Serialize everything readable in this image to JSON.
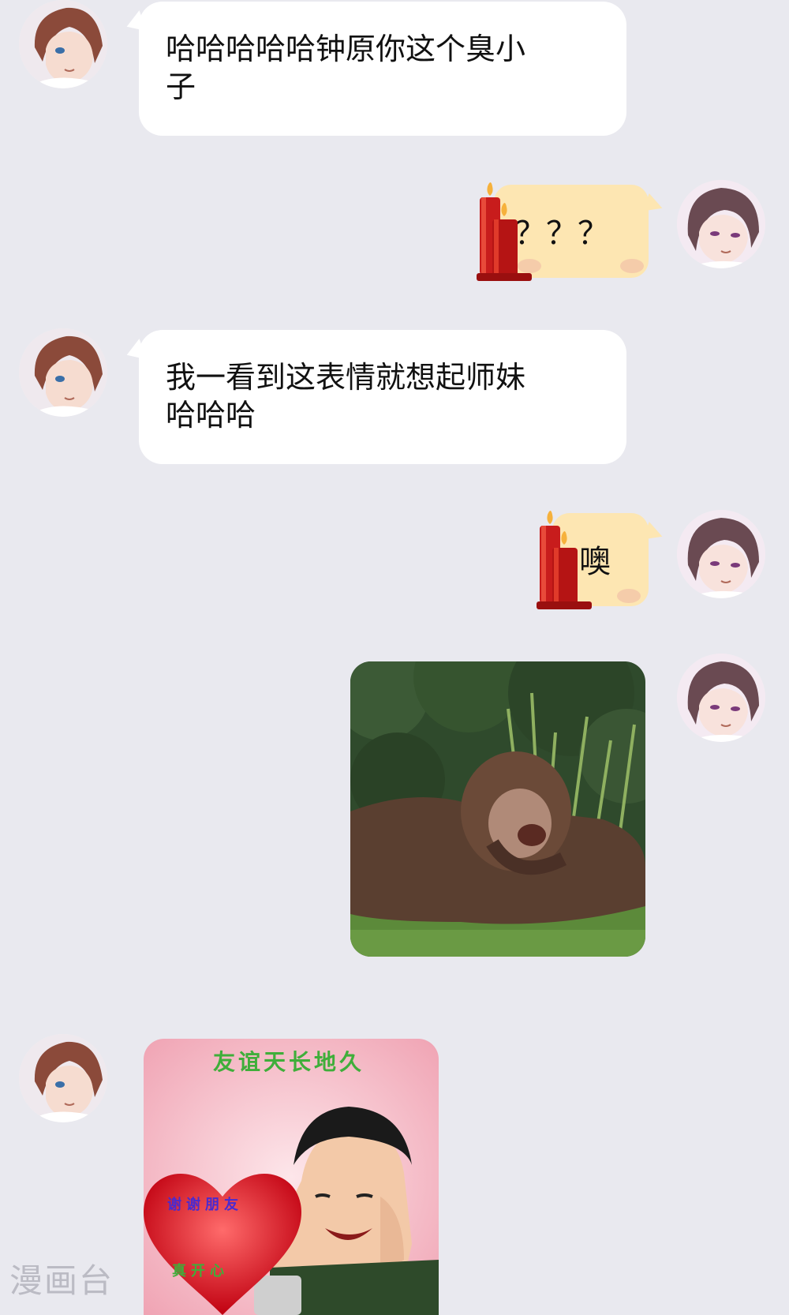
{
  "messages": [
    {
      "sender": "friend",
      "text_line1": "哈哈哈哈哈钟原你这个臭小",
      "text_line2": "子"
    },
    {
      "sender": "me",
      "text": "？？？"
    },
    {
      "sender": "friend",
      "text_line1": "我一看到这表情就想起师妹",
      "text_line2": "哈哈哈"
    },
    {
      "sender": "me",
      "text": "噢"
    },
    {
      "sender": "me",
      "type": "image",
      "image_desc": "monkey sticker"
    },
    {
      "sender": "friend",
      "type": "image",
      "banner_text": "友谊天长地久",
      "heart_text_1": "谢谢朋友",
      "heart_text_2": "真开心"
    }
  ],
  "watermark": "漫画台",
  "colors": {
    "background": "#e9e9ef",
    "friend_bubble": "#ffffff",
    "my_bubble": "#fde6b2"
  }
}
